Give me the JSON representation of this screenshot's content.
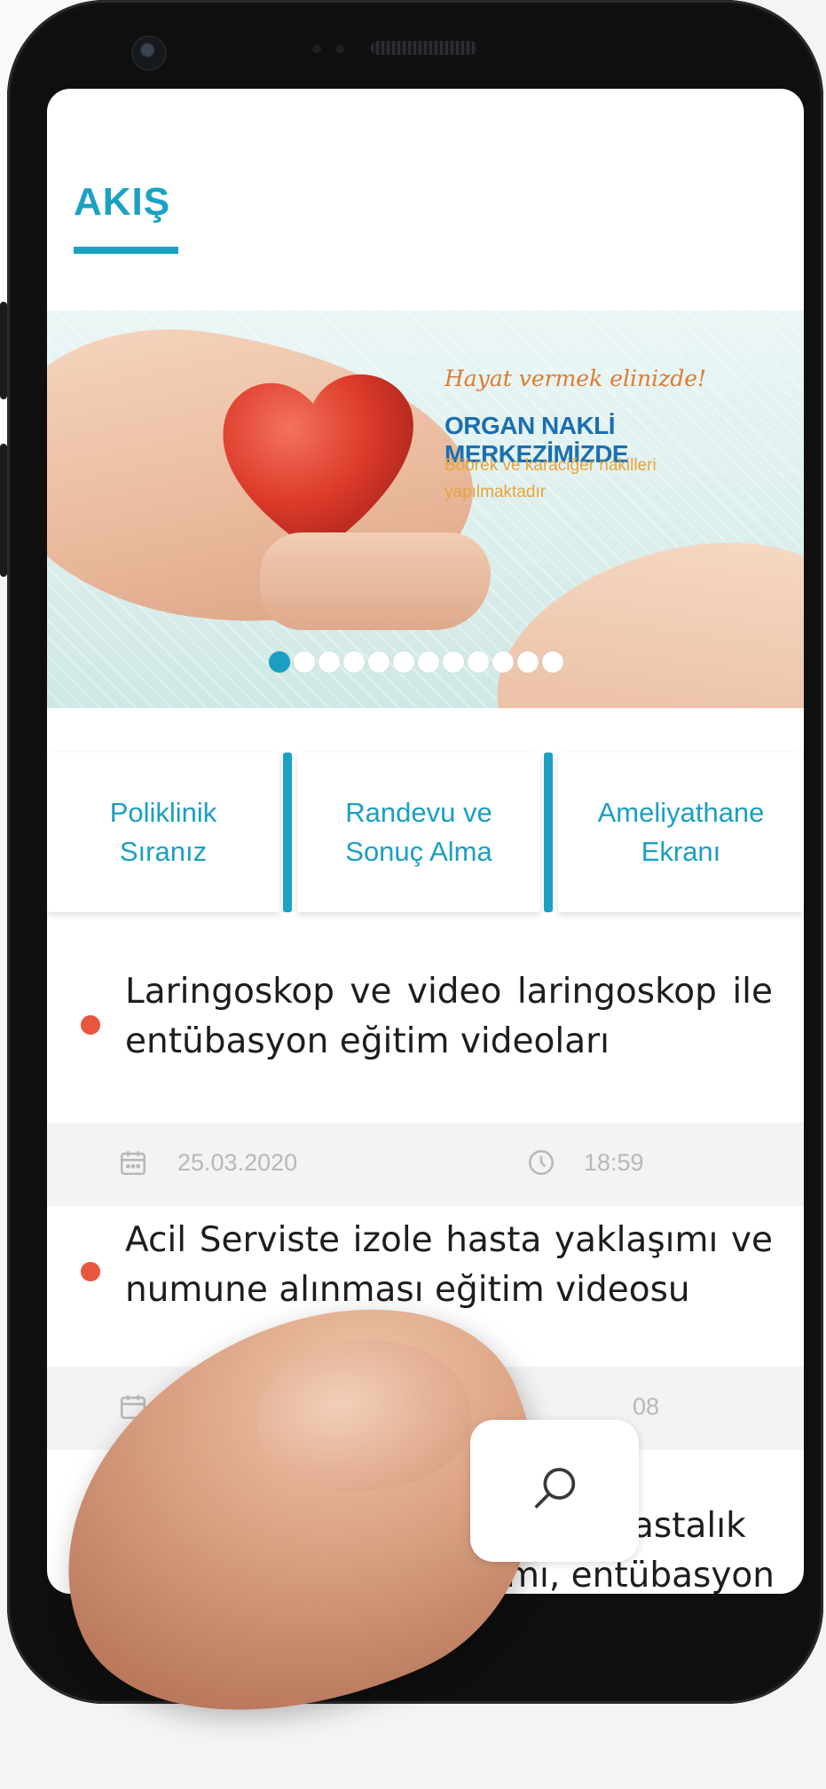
{
  "app": {
    "title": "AKIŞ"
  },
  "banner": {
    "tagline": "Hayat vermek elinizde!",
    "headline": "ORGAN NAKLİ MERKEZİMİZDE",
    "subtitle": "Böbrek ve karaciğer nakilleri yapılmaktadır",
    "slide_count": 12,
    "active_slide": 1
  },
  "quick_links": [
    {
      "label": "Poliklinik\nSıranız"
    },
    {
      "label": "Randevu ve\nSonuç Alma"
    },
    {
      "label": "Ameliyathane\nEkranı"
    }
  ],
  "feed": [
    {
      "title": "Laringoskop ve video laringoskop ile entübasyon eğitim videoları",
      "date": "25.03.2020",
      "time": "18:59"
    },
    {
      "title": "Acil Serviste izole hasta yaklaşımı ve numune alınması eğitim videosu",
      "time_partial": "08"
    },
    {
      "title_partial_1": "astalık",
      "title_partial_2": "yaklaşımı, entübasyon"
    }
  ],
  "icons": {
    "calendar": "calendar-icon",
    "clock": "clock-icon",
    "search": "search-icon"
  },
  "colors": {
    "accent": "#1ba1c4",
    "bullet": "#e8563e",
    "meta_text": "#b8b8b8"
  }
}
